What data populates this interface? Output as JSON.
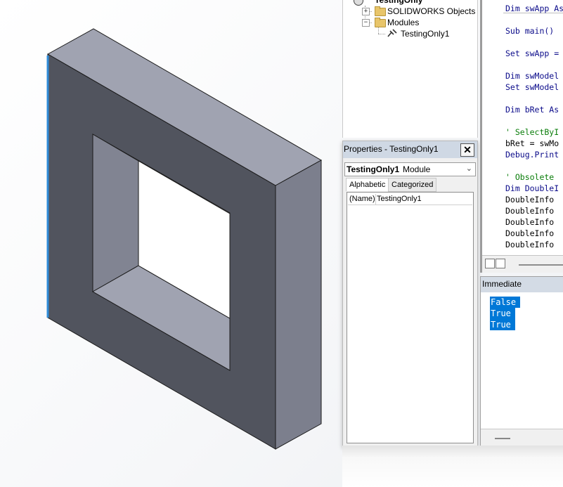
{
  "project_tree": {
    "root_label": "TestingOnly",
    "items": [
      {
        "label": "SOLIDWORKS Objects",
        "toggle": "+"
      },
      {
        "label": "Modules",
        "toggle": "−"
      },
      {
        "label": "TestingOnly1"
      }
    ]
  },
  "properties": {
    "title": "Properties - TestingOnly1",
    "close_label": "✕",
    "object_name": "TestingOnly1",
    "object_type": "Module",
    "tabs": [
      "Alphabetic",
      "Categorized"
    ],
    "rows": [
      {
        "key": "(Name)",
        "value": "TestingOnly1"
      }
    ]
  },
  "code": {
    "lines": [
      "Dim swApp As",
      "",
      "Sub main()",
      "",
      "Set swApp = ",
      "",
      "Dim swModel",
      "Set swModel",
      "",
      "Dim bRet As",
      "",
      "' SelectByI",
      "bRet = swMo",
      "Debug.Print",
      "",
      "' Obsolete ",
      "Dim DoubleI",
      "DoubleInfo",
      "DoubleInfo",
      "DoubleInfo",
      "DoubleInfo",
      "DoubleInfo"
    ]
  },
  "immediate": {
    "title": "Immediate",
    "lines": [
      "False",
      "True",
      "True"
    ]
  },
  "colors": {
    "part_face_front": "#51545e",
    "part_face_top": "#a0a3b1",
    "part_face_side": "#7c7f8d",
    "selection_edge": "#2f8bd8",
    "selection_bg": "#0078d7"
  }
}
